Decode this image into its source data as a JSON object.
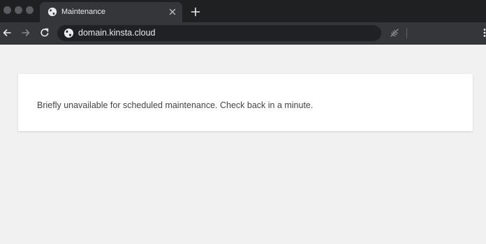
{
  "browser": {
    "tab": {
      "title": "Maintenance",
      "favicon": "globe-icon"
    },
    "address_bar": {
      "url": "domain.kinsta.cloud",
      "site_icon": "globe-icon"
    },
    "icons": {
      "back": "arrow-left-icon",
      "forward": "arrow-right-icon",
      "reload": "reload-icon",
      "extension": "feather-icon",
      "menu": "kebab-menu-icon",
      "new_tab": "plus-icon",
      "close_tab": "close-icon"
    },
    "colors": {
      "tabstrip": "#1f2022",
      "toolbar": "#35363a",
      "omnibox": "#202124",
      "text": "#e8eaed"
    }
  },
  "page": {
    "message": "Briefly unavailable for scheduled maintenance. Check back in a minute.",
    "colors": {
      "background": "#f1f1f1",
      "card": "#ffffff",
      "text": "#444444"
    }
  }
}
